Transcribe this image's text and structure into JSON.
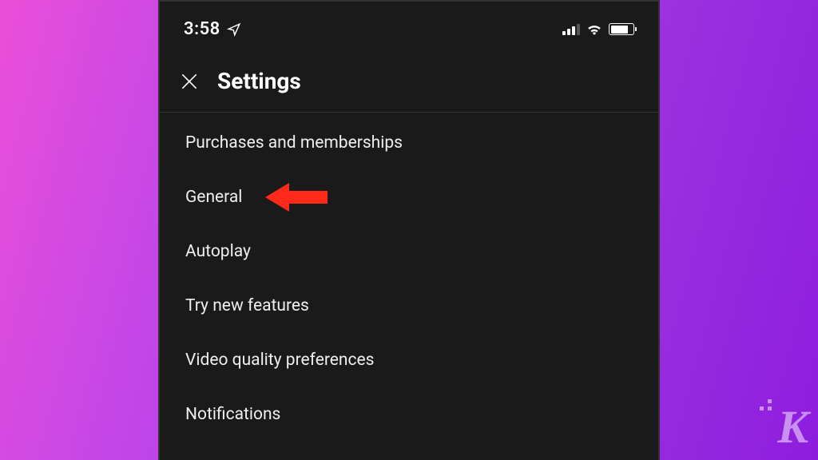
{
  "status_bar": {
    "time": "3:58"
  },
  "header": {
    "title": "Settings"
  },
  "settings": {
    "items": [
      {
        "label": "Purchases and memberships"
      },
      {
        "label": "General"
      },
      {
        "label": "Autoplay"
      },
      {
        "label": "Try new features"
      },
      {
        "label": "Video quality preferences"
      },
      {
        "label": "Notifications"
      }
    ]
  },
  "watermark": {
    "letter": "K"
  }
}
